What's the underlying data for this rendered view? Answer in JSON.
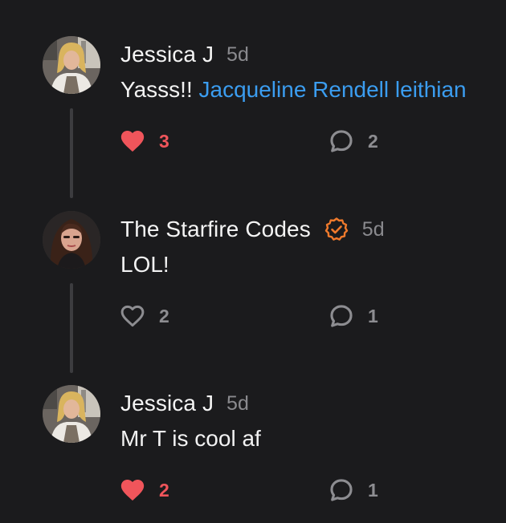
{
  "comments": [
    {
      "author": "Jessica J",
      "time": "5d",
      "verified": false,
      "text": "Yasss!!",
      "mention": "Jacqueline Rendell leithian",
      "liked": true,
      "like_count": "3",
      "reply_count": "2",
      "avatar_icon": "avatar-blonde-woman"
    },
    {
      "author": "The Starfire Codes",
      "time": "5d",
      "verified": true,
      "text": "LOL!",
      "liked": false,
      "like_count": "2",
      "reply_count": "1",
      "avatar_icon": "avatar-dark-haired-woman"
    },
    {
      "author": "Jessica J",
      "time": "5d",
      "verified": false,
      "text": "Mr T is cool af",
      "liked": true,
      "like_count": "2",
      "reply_count": "1",
      "avatar_icon": "avatar-blonde-woman"
    }
  ],
  "icons": {
    "like": "heart-icon",
    "reply": "speech-bubble-icon",
    "verified": "verified-badge-icon"
  },
  "colors": {
    "background": "#1b1b1d",
    "liked": "#f0555b",
    "muted": "#8a8a8e",
    "mention": "#3b9df0",
    "verified": "#f07a2c",
    "thread_line": "#3c3c3f"
  }
}
